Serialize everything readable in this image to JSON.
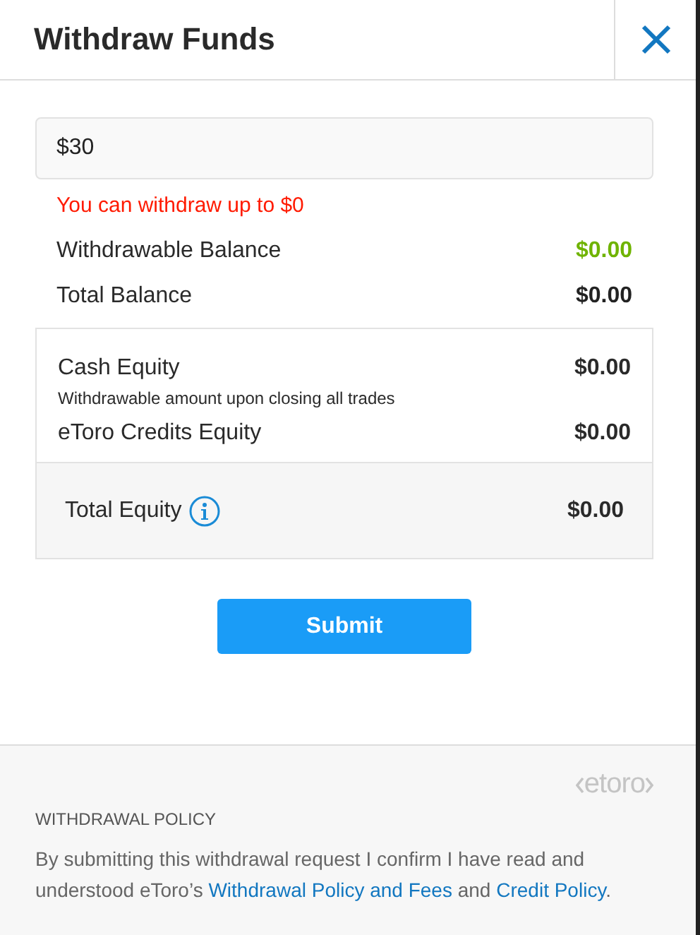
{
  "window": {
    "title": "Withdraw Funds"
  },
  "amount": {
    "value": "$30"
  },
  "error": "You can withdraw up to $0",
  "balances": [
    {
      "label": "Withdrawable Balance",
      "value": "$0.00",
      "color": "#6fb300"
    },
    {
      "label": "Total Balance",
      "value": "$0.00",
      "color": "#222222"
    }
  ],
  "equity": {
    "items": [
      {
        "label": "Cash Equity",
        "value": "$0.00",
        "note": "Withdrawable amount upon closing all trades"
      },
      {
        "label": "eToro Credits Equity",
        "value": "$0.00"
      }
    ],
    "total": {
      "label": "Total Equity",
      "value": "$0.00"
    }
  },
  "submit": "Submit",
  "footer": {
    "logo": "etoro",
    "heading": "WITHDRAWAL POLICY",
    "text": [
      "By submitting this withdrawal request I confirm I have read and understood eToro’s ",
      {
        "link": "Withdrawal Policy and Fees"
      },
      " and ",
      {
        "link": "Credit Policy"
      },
      "."
    ]
  }
}
